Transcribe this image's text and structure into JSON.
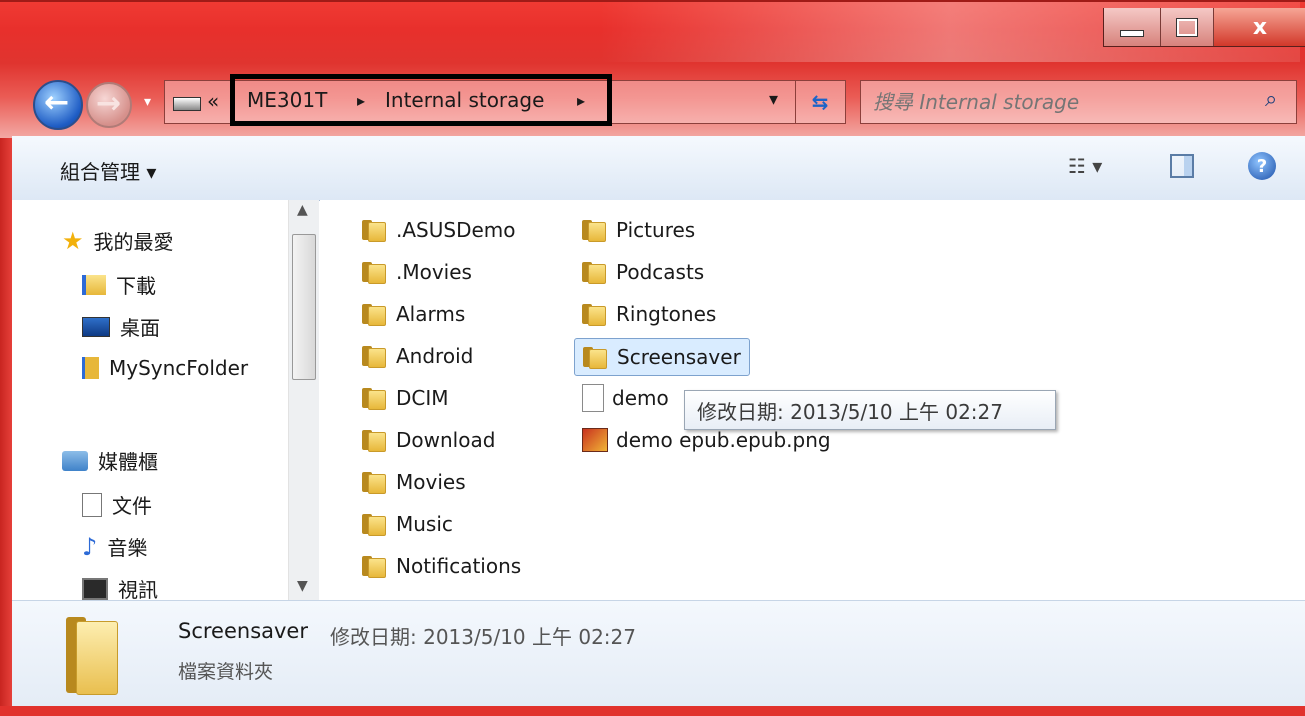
{
  "window": {
    "controls": {
      "close": "x"
    }
  },
  "address": {
    "crumbs": [
      "ME301T",
      "Internal storage"
    ],
    "overflow": "«",
    "sep": "▸"
  },
  "search": {
    "placeholder": "搜尋 Internal storage"
  },
  "toolbar": {
    "organize": "組合管理 ▾"
  },
  "nav": {
    "favorites": "我的最愛",
    "items_fav": [
      "下載",
      "桌面",
      "MySyncFolder"
    ],
    "libraries": "媒體櫃",
    "items_lib": [
      "文件",
      "音樂",
      "視訊"
    ]
  },
  "files": {
    "col1": [
      ".ASUSDemo",
      ".Movies",
      "Alarms",
      "Android",
      "DCIM",
      "Download",
      "Movies",
      "Music",
      "Notifications"
    ],
    "col2_folders": [
      "Pictures",
      "Podcasts",
      "Ringtones",
      "Screensaver"
    ],
    "file_demo": "demo",
    "file_png": "demo epub.epub.png"
  },
  "tooltip": {
    "text": "修改日期: 2013/5/10 上午 02:27"
  },
  "details": {
    "name": "Screensaver",
    "modified": "修改日期: 2013/5/10 上午 02:27",
    "type": "檔案資料夾"
  },
  "colors": {
    "accent_red": "#e8302c",
    "selection": "#cce8ff"
  }
}
